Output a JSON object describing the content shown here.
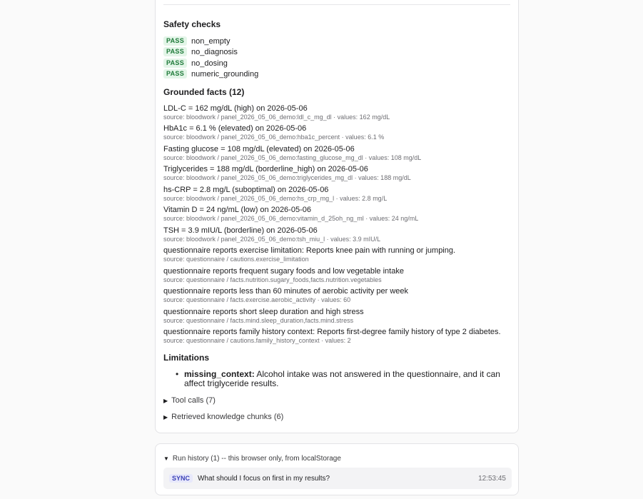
{
  "safety": {
    "heading": "Safety checks",
    "checks": [
      {
        "status": "PASS",
        "name": "non_empty"
      },
      {
        "status": "PASS",
        "name": "no_diagnosis"
      },
      {
        "status": "PASS",
        "name": "no_dosing"
      },
      {
        "status": "PASS",
        "name": "numeric_grounding"
      }
    ]
  },
  "facts": {
    "heading": "Grounded facts (12)",
    "items": [
      {
        "title": "LDL-C = 162 mg/dL (high) on 2026-05-06",
        "source": "source: bloodwork / panel_2026_05_06_demo:ldl_c_mg_dl · values: 162 mg/dL"
      },
      {
        "title": "HbA1c = 6.1 % (elevated) on 2026-05-06",
        "source": "source: bloodwork / panel_2026_05_06_demo:hba1c_percent · values: 6.1 %"
      },
      {
        "title": "Fasting glucose = 108 mg/dL (elevated) on 2026-05-06",
        "source": "source: bloodwork / panel_2026_05_06_demo:fasting_glucose_mg_dl · values: 108 mg/dL"
      },
      {
        "title": "Triglycerides = 188 mg/dL (borderline_high) on 2026-05-06",
        "source": "source: bloodwork / panel_2026_05_06_demo:triglycerides_mg_dl · values: 188 mg/dL"
      },
      {
        "title": "hs-CRP = 2.8 mg/L (suboptimal) on 2026-05-06",
        "source": "source: bloodwork / panel_2026_05_06_demo:hs_crp_mg_l · values: 2.8 mg/L"
      },
      {
        "title": "Vitamin D = 24 ng/mL (low) on 2026-05-06",
        "source": "source: bloodwork / panel_2026_05_06_demo:vitamin_d_25oh_ng_ml · values: 24 ng/mL"
      },
      {
        "title": "TSH = 3.9 mIU/L (borderline) on 2026-05-06",
        "source": "source: bloodwork / panel_2026_05_06_demo:tsh_miu_l · values: 3.9 mIU/L"
      },
      {
        "title": "questionnaire reports exercise limitation: Reports knee pain with running or jumping.",
        "source": "source: questionnaire / cautions.exercise_limitation"
      },
      {
        "title": "questionnaire reports frequent sugary foods and low vegetable intake",
        "source": "source: questionnaire / facts.nutrition.sugary_foods,facts.nutrition.vegetables"
      },
      {
        "title": "questionnaire reports less than 60 minutes of aerobic activity per week",
        "source": "source: questionnaire / facts.exercise.aerobic_activity · values: 60"
      },
      {
        "title": "questionnaire reports short sleep duration and high stress",
        "source": "source: questionnaire / facts.mind.sleep_duration,facts.mind.stress"
      },
      {
        "title": "questionnaire reports family history context: Reports first-degree family history of type 2 diabetes.",
        "source": "source: questionnaire / cautions.family_history_context · values: 2"
      }
    ]
  },
  "limitations": {
    "heading": "Limitations",
    "items": [
      {
        "key": "missing_context:",
        "text": "Alcohol intake was not answered in the questionnaire, and it can affect triglyceride results."
      }
    ]
  },
  "toggles": {
    "tool_calls": "Tool calls (7)",
    "chunks": "Retrieved knowledge chunks (6)",
    "caret_icon": "triangle-right-icon"
  },
  "history": {
    "summary": "Run history (1) -- this browser only, from localStorage",
    "caret_icon": "triangle-down-icon",
    "runs": [
      {
        "badge": "SYNC",
        "question": "What should I focus on first in my results?",
        "time": "12:53:45"
      }
    ]
  },
  "colors": {
    "pass_bg": "#e3f5e8",
    "pass_fg": "#1e7a39",
    "sync_bg": "#e7e8fb",
    "sync_fg": "#3a3fb5"
  }
}
